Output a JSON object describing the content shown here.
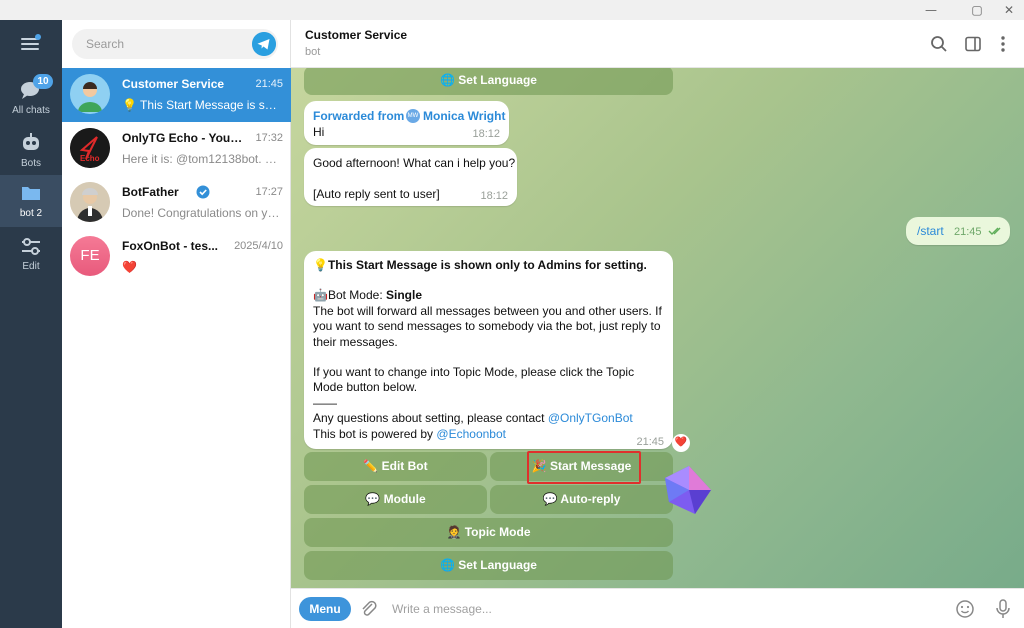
{
  "window": {
    "minimize_glyph": "—",
    "maximize_glyph": "▢",
    "close_glyph": "✕"
  },
  "rail": {
    "items": [
      {
        "label": "All chats",
        "badge": "10",
        "icon": "chat-bubbles-icon"
      },
      {
        "label": "Bots",
        "icon": "robot-icon"
      },
      {
        "label": "bot 2",
        "icon": "folder-icon"
      },
      {
        "label": "Edit",
        "icon": "sliders-icon"
      }
    ]
  },
  "list": {
    "search_placeholder": "Search",
    "chats": [
      {
        "name": "Customer Service",
        "time": "21:45",
        "preview": "💡 This Start Message is show..."
      },
      {
        "name": "OnlyTG Echo - Your ...",
        "time": "17:32",
        "preview": "Here it is: @tom12138bot. Wh...",
        "avatar_text": "Echo"
      },
      {
        "name": "BotFather",
        "time": "17:27",
        "preview": "Done! Congratulations on you..."
      },
      {
        "name": "FoxOnBot - tes...",
        "time": "2025/4/10",
        "preview": "❤️",
        "avatar_text": "FE"
      }
    ]
  },
  "header": {
    "title": "Customer Service",
    "subtitle": "bot"
  },
  "messages": {
    "top_button": "🌐 Set Language",
    "fwd_label": "Forwarded from",
    "fwd_initials": "MW",
    "fwd_name": "Monica Wright",
    "fwd_text": "Hi",
    "fwd_time": "18:12",
    "reply_line1": "Good afternoon!  What can i help you?",
    "reply_line2": "[Auto reply sent to user]",
    "reply_time": "18:12",
    "out_text": "/start",
    "out_time": "21:45",
    "start_title": "This Start Message is shown only to Admins for setting.",
    "start_mode_prefix": "Bot Mode: ",
    "start_mode_value": "Single",
    "start_p1": "The bot will forward all messages between you and other users. If you want to send messages to somebody via the bot, just reply to their messages.",
    "start_p2": "If you want to change into Topic Mode, please click the Topic Mode button below.",
    "start_sep": "——",
    "start_q_prefix": "Any questions about setting, please contact ",
    "start_q_link": "@OnlyTGonBot",
    "start_p_prefix": "This bot is powered by ",
    "start_p_link": "@Echoonbot",
    "start_time": "21:45",
    "reaction": "❤️",
    "buttons": {
      "edit_bot": "✏️ Edit Bot",
      "start_message": "🎉 Start Message",
      "module": "💬 Module",
      "auto_reply": "💬 Auto-reply",
      "topic_mode": "🤵 Topic Mode",
      "set_language": "🌐 Set Language"
    }
  },
  "composer": {
    "menu": "Menu",
    "placeholder": "Write a message..."
  },
  "colors": {
    "accent": "#3390d8",
    "rail": "#2b3a4a",
    "highlight": "#e0302c"
  }
}
